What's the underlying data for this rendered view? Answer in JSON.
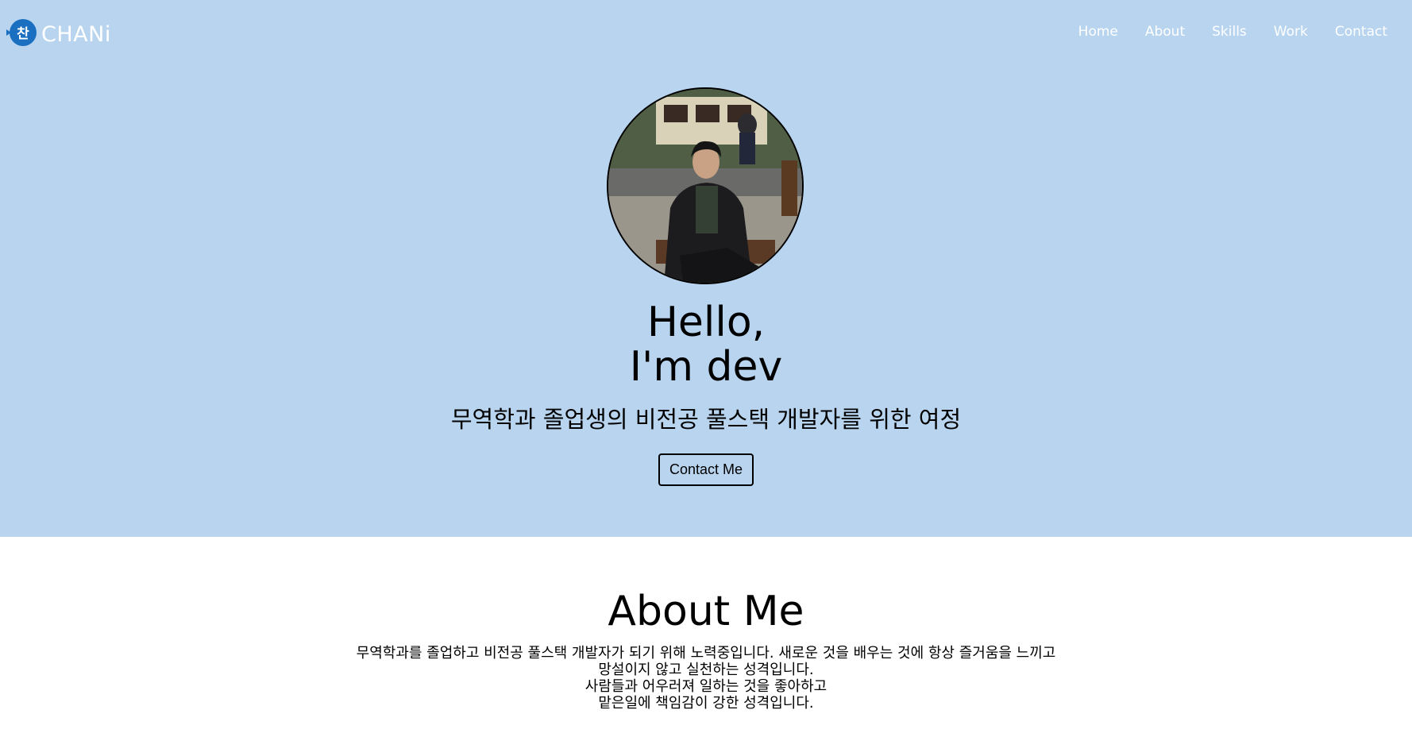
{
  "header": {
    "logo_badge": "찬",
    "logo_text": "CHANi",
    "nav": [
      "Home",
      "About",
      "Skills",
      "Work",
      "Contact"
    ]
  },
  "home": {
    "hello_line1": "Hello,",
    "hello_line2": "I'm dev",
    "tagline": "무역학과 졸업생의 비전공 풀스택 개발자를 위한 여정",
    "contact_button": "Contact Me"
  },
  "about": {
    "title": "About Me",
    "lines": [
      "무역학과를 졸업하고 비전공 풀스택 개발자가 되기 위해 노력중입니다. 새로운 것을 배우는 것에 항상 즐거움을 느끼고",
      "망설이지 않고 실천하는 성격입니다.",
      "사람들과 어우러져 일하는 것을 좋아하고",
      "맡은일에 책임감이 강한 성격입니다."
    ]
  },
  "colors": {
    "hero_background": "#b8d4ef",
    "logo_badge": "#1a6fc0"
  }
}
